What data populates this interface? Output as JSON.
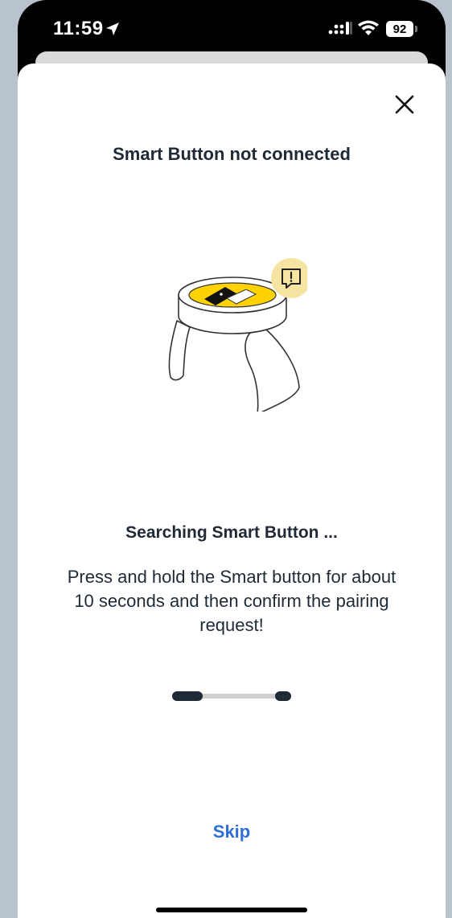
{
  "status_bar": {
    "time": "11:59",
    "battery": "92"
  },
  "sheet": {
    "title": "Smart Button not connected",
    "searching_label": "Searching Smart Button ...",
    "instructions": "Press and hold the Smart button for about 10 seconds and then confirm the pairing request!",
    "skip_label": "Skip"
  },
  "icons": {
    "location": "location-arrow-icon",
    "signal": "cellular-signal-icon",
    "wifi": "wifi-icon",
    "battery": "battery-icon",
    "close": "close-icon",
    "alert": "alert-message-icon"
  },
  "colors": {
    "accent_yellow": "#ffd200",
    "alert_badge": "#f6e4a3",
    "link_blue": "#2f6fd6",
    "text_dark": "#1f2a36"
  }
}
